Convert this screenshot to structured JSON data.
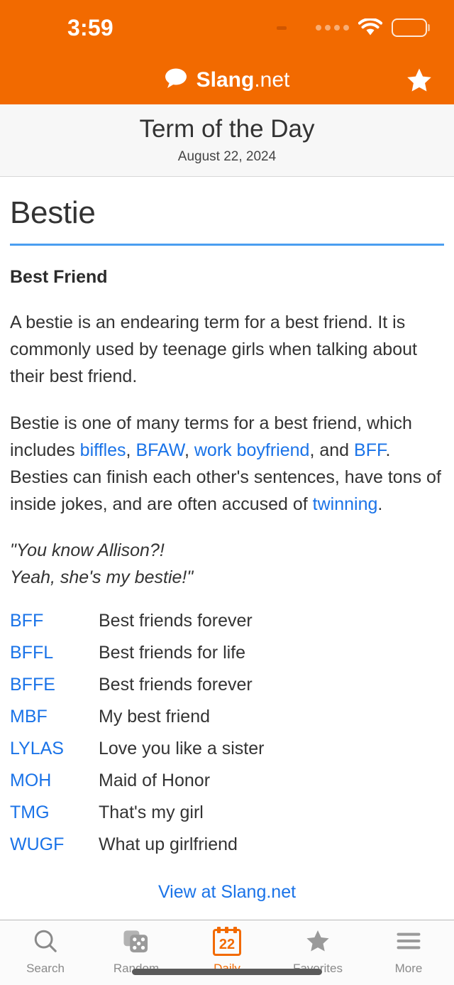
{
  "status_bar": {
    "time": "3:59",
    "signal_icon": "signal-dots-icon",
    "wifi_icon": "wifi-icon",
    "battery_icon": "battery-full-icon"
  },
  "brand": {
    "icon": "speech-bubble-icon",
    "name_bold": "Slang",
    "name_light": ".net",
    "favorite_icon": "star-icon"
  },
  "subheader": {
    "title": "Term of the Day",
    "date": "August 22, 2024"
  },
  "term": {
    "name": "Bestie",
    "definition_heading": "Best Friend",
    "paragraph1": "A bestie is an endearing term for a best friend. It is commonly used by teenage girls when talking about their best friend.",
    "paragraph2_parts": {
      "t1": "Bestie is one of many terms for a best friend, which includes ",
      "link1": "biffles",
      "t2": ", ",
      "link2": "BFAW",
      "t3": ", ",
      "link3": "work boyfriend",
      "t4": ", and ",
      "link4": "BFF",
      "t5": ". Besties can finish each other's sentences, have tons of inside jokes, and are often accused of ",
      "link5": "twinning",
      "t6": "."
    },
    "example_line1": "\"You know Allison?!",
    "example_line2": "Yeah, she's my bestie!\""
  },
  "related_terms": [
    {
      "abbr": "BFF",
      "definition": "Best friends forever"
    },
    {
      "abbr": "BFFL",
      "definition": "Best friends for life"
    },
    {
      "abbr": "BFFE",
      "definition": "Best friends forever"
    },
    {
      "abbr": "MBF",
      "definition": "My best friend"
    },
    {
      "abbr": "LYLAS",
      "definition": "Love you like a sister"
    },
    {
      "abbr": "MOH",
      "definition": "Maid of Honor"
    },
    {
      "abbr": "TMG",
      "definition": "That's my girl"
    },
    {
      "abbr": "WUGF",
      "definition": "What up girlfriend"
    }
  ],
  "view_link": "View at Slang.net",
  "tab_bar": {
    "tabs": [
      {
        "label": "Search",
        "icon": "magnifier-icon",
        "active": false
      },
      {
        "label": "Random",
        "icon": "dice-icon",
        "active": false
      },
      {
        "label": "Daily",
        "icon": "calendar-icon",
        "active": true,
        "calendar_day": "22"
      },
      {
        "label": "Favorites",
        "icon": "star-icon",
        "active": false
      },
      {
        "label": "More",
        "icon": "hamburger-icon",
        "active": false
      }
    ]
  },
  "colors": {
    "brand_orange": "#f26a00",
    "link_blue": "#1a73e8",
    "rule_blue": "#4a9ef0",
    "subheader_bg": "#f7f7f7",
    "inactive_tab": "#8a8a8a"
  }
}
